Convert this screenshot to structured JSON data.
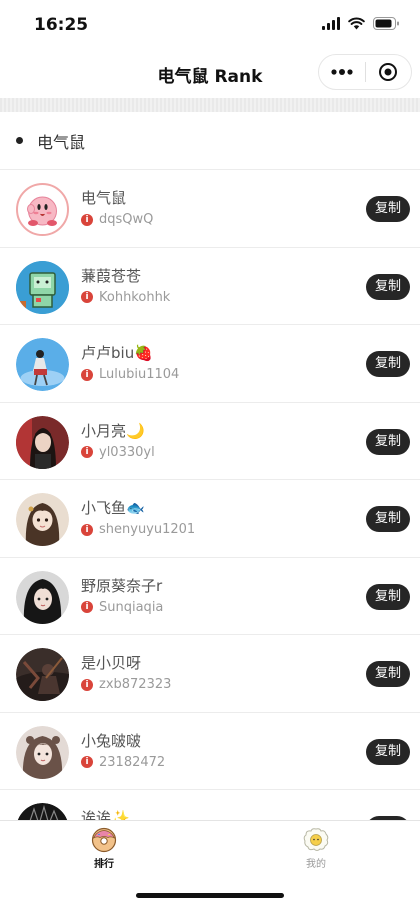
{
  "status_bar": {
    "time": "16:25"
  },
  "nav": {
    "title": "电气鼠 Rank"
  },
  "section": {
    "title": "电气鼠"
  },
  "copy_label": "复制",
  "rows": [
    {
      "name": "电气鼠",
      "id": "dqsQwQ",
      "avatar": "kirby-avatar"
    },
    {
      "name": "蒹葭苍苍",
      "id": "Kohhkohhk",
      "avatar": "robot-avatar"
    },
    {
      "name": "卢卢biu🍓",
      "id": "Lulubiu1104",
      "avatar": "girl-sky-avatar"
    },
    {
      "name": "小月亮🌙",
      "id": "yl0330yl",
      "avatar": "portrait-avatar"
    },
    {
      "name": "小飞鱼🐟",
      "id": "shenyuyu1201",
      "avatar": "anime-girl-avatar"
    },
    {
      "name": "野原葵奈子r",
      "id": "Sunqiaqia",
      "avatar": "portrait-avatar"
    },
    {
      "name": "是小贝呀",
      "id": "zxb872323",
      "avatar": "dark-art-avatar"
    },
    {
      "name": "小兔啵啵",
      "id": "23182472",
      "avatar": "portrait-avatar"
    },
    {
      "name": "诶诶✨",
      "id": "",
      "avatar": "dark-avatar"
    }
  ],
  "tabs": [
    {
      "label": "排行",
      "active": true,
      "icon": "donut-icon"
    },
    {
      "label": "我的",
      "active": false,
      "icon": "egg-icon"
    }
  ],
  "colors": {
    "copy_button": "#262626",
    "info_dot": "#d9443a",
    "active_tab": "#111111",
    "inactive_tab": "#999999"
  }
}
